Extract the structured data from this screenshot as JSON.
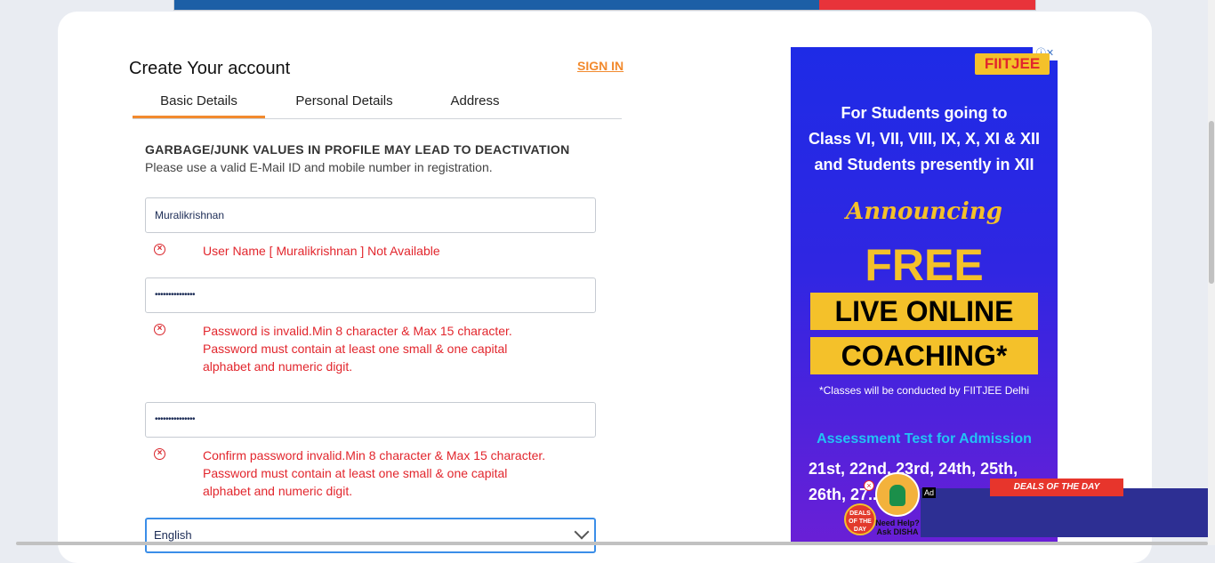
{
  "header": {
    "title": "Create Your account",
    "signin": "SIGN IN"
  },
  "tabs": [
    {
      "label": "Basic Details",
      "active": true
    },
    {
      "label": "Personal Details",
      "active": false
    },
    {
      "label": "Address",
      "active": false
    }
  ],
  "notice": {
    "title": "GARBAGE/JUNK VALUES IN PROFILE MAY LEAD TO DEACTIVATION",
    "subtitle": "Please use a valid E-Mail ID and mobile number in registration."
  },
  "form": {
    "username": {
      "value": "Muralikrishnan",
      "error": "User Name [ Muralikrishnan ] Not Available"
    },
    "password": {
      "value": "•••••••••••••••",
      "error_lines": [
        "Password is invalid.Min 8 character & Max 15 character.",
        "Password must contain at least one small & one capital",
        "alphabet and numeric digit."
      ]
    },
    "confirm_password": {
      "value": "•••••••••••••••",
      "error_lines": [
        "Confirm password invalid.Min 8 character & Max 15 character.",
        "Password must contain at least one small & one capital",
        "alphabet and numeric digit."
      ]
    },
    "language": {
      "selected": "English"
    }
  },
  "ad": {
    "brand": "FIITJEE",
    "line1": [
      "For Students going to",
      "Class VI, VII, VIII, IX, X, XI & XII",
      "and Students presently in XII"
    ],
    "announcing": "Announcing",
    "free": "FREE",
    "live": "LIVE ONLINE",
    "coaching": "COACHING*",
    "note": "*Classes will be conducted by FIITJEE Delhi",
    "assessment": "Assessment Test for Admission",
    "dates": [
      "21st, 22nd, 23rd, 24th, 25th,",
      "26th, 27..."
    ]
  },
  "bottom_ad": {
    "deals": "DEALS OF THE DAY",
    "ad_label": "Ad",
    "help": [
      "Need Help?",
      "Ask DISHA"
    ],
    "deal_badge": [
      "DEALS",
      "OF THE",
      "DAY"
    ]
  },
  "colors": {
    "accent": "#f28a2e",
    "error": "#e2262d",
    "ad_blue": "#1e2be6",
    "ad_yellow": "#f4c12a"
  }
}
